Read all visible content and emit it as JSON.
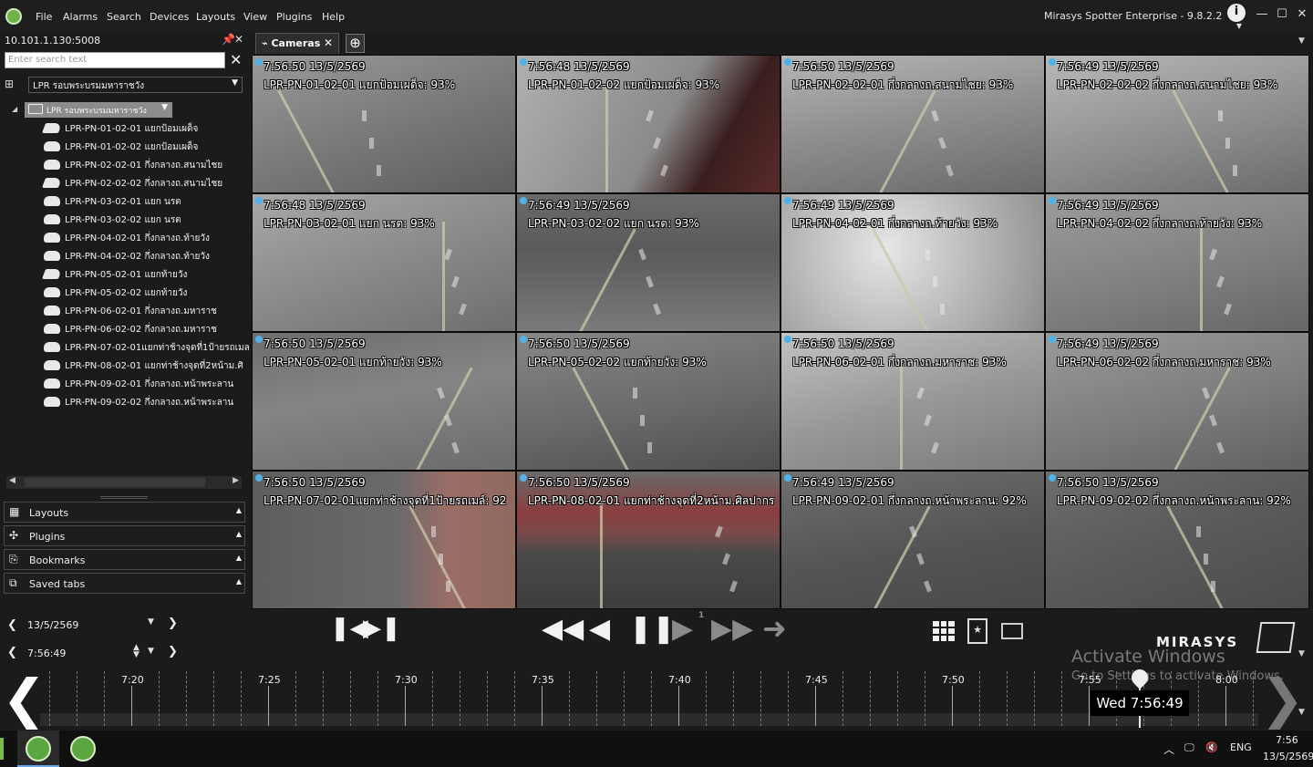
{
  "menu": {
    "items": [
      "File",
      "Alarms",
      "Search",
      "Devices",
      "Layouts",
      "View",
      "Plugins",
      "Help"
    ],
    "app_title": "Mirasys Spotter Enterprise - 9.8.2.2"
  },
  "left_panel": {
    "server": "10.101.1.130:5008",
    "search_placeholder": "Enter search text",
    "combo_value": "LPR รอบพระบรมมหาราชวัง",
    "folder": "LPR รอบพระบรมมหาราชวัง",
    "cameras": [
      {
        "name": "LPR-PN-01-02-01 แยกป้อมเผด็จ",
        "icon": "ptz-camera-icon"
      },
      {
        "name": "LPR-PN-01-02-02 แยกป้อมเผด็จ",
        "icon": "dome-camera-icon"
      },
      {
        "name": "LPR-PN-02-02-01 กึ่งกลางถ.สนามไชย",
        "icon": "dome-camera-icon"
      },
      {
        "name": "LPR-PN-02-02-02 กึ่งกลางถ.สนามไชย",
        "icon": "ptz-camera-icon"
      },
      {
        "name": "LPR-PN-03-02-01 แยก นรต",
        "icon": "dome-camera-icon"
      },
      {
        "name": "LPR-PN-03-02-02 แยก นรต",
        "icon": "dome-camera-icon"
      },
      {
        "name": "LPR-PN-04-02-01 กึ่งกลางถ.ท้ายวัง",
        "icon": "dome-camera-icon"
      },
      {
        "name": "LPR-PN-04-02-02 กึ่งกลางถ.ท้ายวัง",
        "icon": "dome-camera-icon"
      },
      {
        "name": "LPR-PN-05-02-01 แยกท้ายวัง",
        "icon": "ptz-camera-icon"
      },
      {
        "name": "LPR-PN-05-02-02 แยกท้ายวัง",
        "icon": "dome-camera-icon"
      },
      {
        "name": "LPR-PN-06-02-01 กึ่งกลางถ.มหาราช",
        "icon": "dome-camera-icon"
      },
      {
        "name": "LPR-PN-06-02-02 กึ่งกลางถ.มหาราช",
        "icon": "dome-camera-icon"
      },
      {
        "name": "LPR-PN-07-02-01แยกท่าช้างจุดที่1ป้ายรถเมล",
        "icon": "dome-camera-icon"
      },
      {
        "name": "LPR-PN-08-02-01 แยกท่าช้างจุดที่2หน้าม.ศิ",
        "icon": "dome-camera-icon"
      },
      {
        "name": "LPR-PN-09-02-01 กึ่งกลางถ.หน้าพระลาน",
        "icon": "dome-camera-icon"
      },
      {
        "name": "LPR-PN-09-02-02 กึ่งกลางถ.หน้าพระลาน",
        "icon": "dome-camera-icon"
      }
    ],
    "panels": [
      "Layouts",
      "Plugins",
      "Bookmarks",
      "Saved tabs"
    ]
  },
  "tabs": {
    "active": "Cameras"
  },
  "grid": [
    {
      "time": "7:56:50  13/5/2569",
      "name": "LPR-PN-01-02-01 แยกป้อมเผด็จ: 93%"
    },
    {
      "time": "7:56:48  13/5/2569",
      "name": "LPR-PN-01-02-02 แยกป้อมเผด็จ: 93%"
    },
    {
      "time": "7:56:50  13/5/2569",
      "name": "LPR-PN-02-02-01 กึ่งกลางถ.สนามไชย: 93%"
    },
    {
      "time": "7:56:49  13/5/2569",
      "name": "LPR-PN-02-02-02 กึ่งกลางถ.สนามไชย: 93%"
    },
    {
      "time": "7:56:48  13/5/2569",
      "name": "LPR-PN-03-02-01 แยก นรต: 93%"
    },
    {
      "time": "7:56:49  13/5/2569",
      "name": "LPR-PN-03-02-02 แยก นรต: 93%"
    },
    {
      "time": "7:56:49  13/5/2569",
      "name": "LPR-PN-04-02-01 กึ่งกลางถ.ท้ายวัง: 93%"
    },
    {
      "time": "7:56:49  13/5/2569",
      "name": "LPR-PN-04-02-02 กึ่งกลางถ.ท้ายวัง: 93%"
    },
    {
      "time": "7:56:50  13/5/2569",
      "name": "LPR-PN-05-02-01 แยกท้ายวัง: 93%"
    },
    {
      "time": "7:56:50  13/5/2569",
      "name": "LPR-PN-05-02-02 แยกท้ายวัง: 93%"
    },
    {
      "time": "7:56:50  13/5/2569",
      "name": "LPR-PN-06-02-01 กึ่งกลางถ.มหาราช: 93%"
    },
    {
      "time": "7:56:49  13/5/2569",
      "name": "LPR-PN-06-02-02 กึ่งกลางถ.มหาราช: 93%"
    },
    {
      "time": "7:56:50  13/5/2569",
      "name": "LPR-PN-07-02-01แยกท่าช้างจุดที่1ป้ายรถเมล์: 92"
    },
    {
      "time": "7:56:50  13/5/2569",
      "name": "LPR-PN-08-02-01 แยกท่าช้างจุดที่2หน้าม.ศิลปากร"
    },
    {
      "time": "7:56:49  13/5/2569",
      "name": "LPR-PN-09-02-01 กึ่งกลางถ.หน้าพระลาน: 92%"
    },
    {
      "time": "7:56:50  13/5/2569",
      "name": "LPR-PN-09-02-02 กึ่งกลางถ.หน้าพระลาน: 92%"
    }
  ],
  "controls": {
    "date": "13/5/2569",
    "time": "7:56:49",
    "playback_speed": "1",
    "brand": "MIRASYS",
    "activate_title": "Activate Windows",
    "activate_sub": "Go to Settings to activate Windows."
  },
  "timeline": {
    "labels": [
      "7:20",
      "7:25",
      "7:30",
      "7:35",
      "7:40",
      "7:45",
      "7:50",
      "7:55",
      "8:00"
    ],
    "cursor": "Wed 7:56:49"
  },
  "taskbar": {
    "lang": "ENG",
    "time": "7:56",
    "date": "13/5/2569"
  }
}
